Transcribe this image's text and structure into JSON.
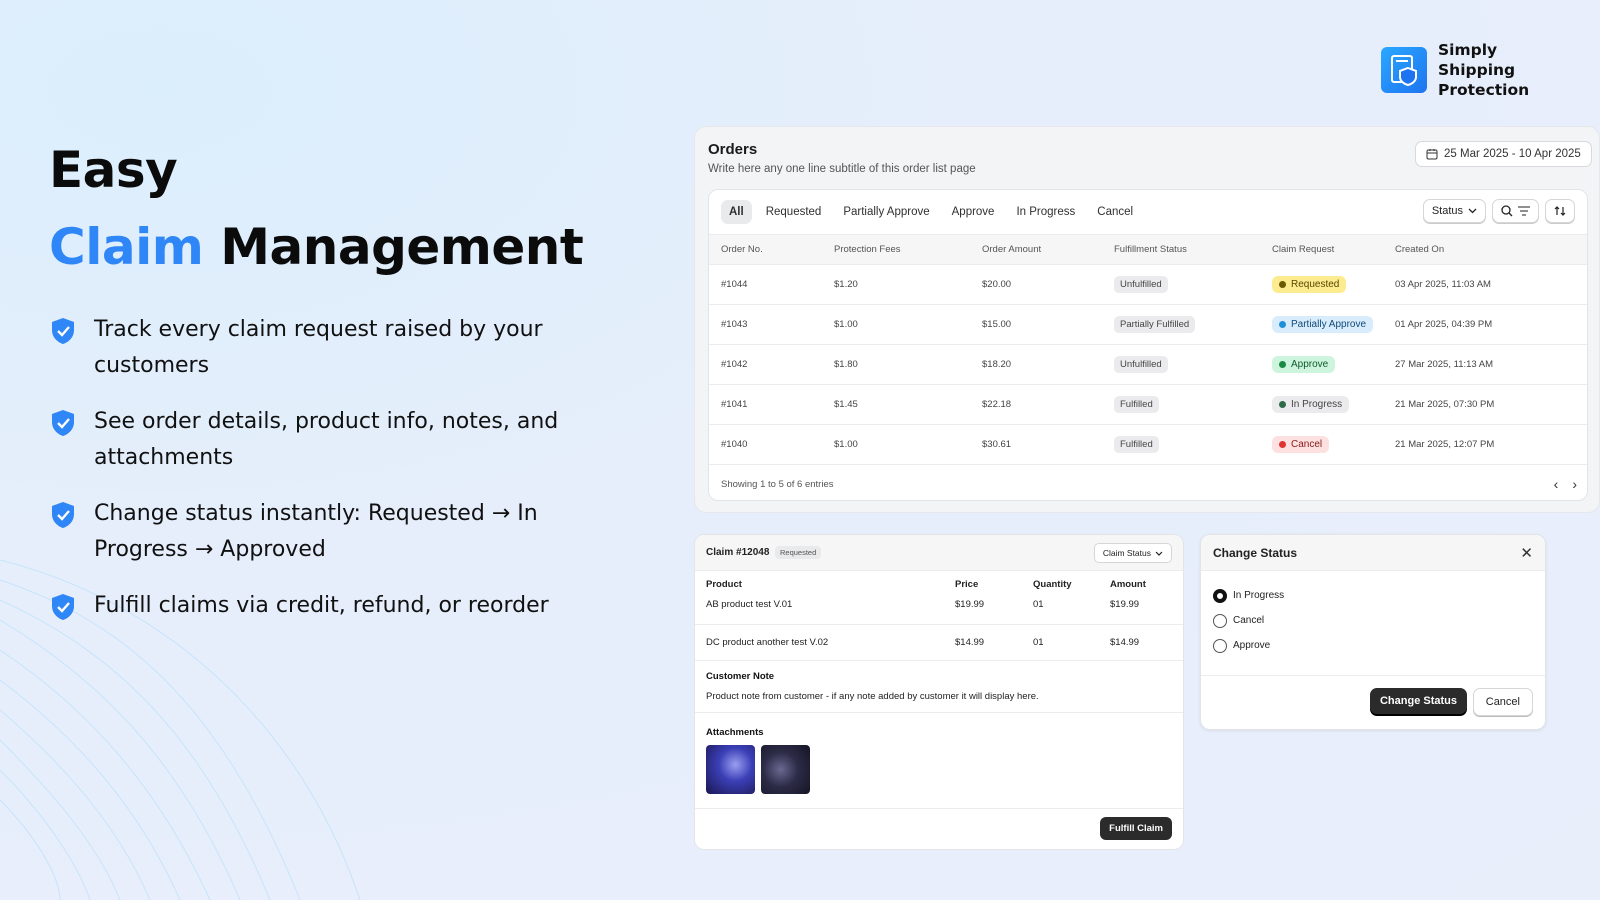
{
  "brand": {
    "name": "Simply Shipping Protection"
  },
  "hero": {
    "title_line1": "Easy",
    "title_accent": "Claim",
    "title_rest": "Management",
    "features": [
      "Track every claim request raised by your customers",
      "See order details, product info, notes, and attachments",
      "Change status instantly: Requested → In Progress → Approved",
      "Fulfill claims via credit, refund, or reorder"
    ]
  },
  "orders": {
    "title": "Orders",
    "subtitle": "Write here any one line subtitle of this order list page",
    "date_range": "25 Mar 2025 - 10 Apr 2025",
    "tabs": [
      "All",
      "Requested",
      "Partially Approve",
      "Approve",
      "In Progress",
      "Cancel"
    ],
    "status_filter_label": "Status",
    "columns": [
      "Order No.",
      "Protection Fees",
      "Order Amount",
      "Fulfillment Status",
      "Claim Request",
      "Created On"
    ],
    "rows": [
      {
        "order": "#1044",
        "fees": "$1.20",
        "amount": "$20.00",
        "fulfillment": "Unfulfilled",
        "claim": "Requested",
        "created": "03 Apr 2025, 11:03 AM"
      },
      {
        "order": "#1043",
        "fees": "$1.00",
        "amount": "$15.00",
        "fulfillment": "Partially Fulfilled",
        "claim": "Partially Approve",
        "created": "01 Apr 2025, 04:39 PM"
      },
      {
        "order": "#1042",
        "fees": "$1.80",
        "amount": "$18.20",
        "fulfillment": "Unfulfilled",
        "claim": "Approve",
        "created": "27 Mar 2025, 11:13 AM"
      },
      {
        "order": "#1041",
        "fees": "$1.45",
        "amount": "$22.18",
        "fulfillment": "Fulfilled",
        "claim": "In Progress",
        "created": "21 Mar 2025, 07:30 PM"
      },
      {
        "order": "#1040",
        "fees": "$1.00",
        "amount": "$30.61",
        "fulfillment": "Fulfilled",
        "claim": "Cancel",
        "created": "21 Mar 2025, 12:07 PM"
      }
    ],
    "footer": "Showing 1 to 5 of 6 entries"
  },
  "claim": {
    "id": "Claim #12048",
    "badge": "Requested",
    "status_button": "Claim Status",
    "columns": [
      "Product",
      "Price",
      "Quantity",
      "Amount"
    ],
    "items": [
      {
        "product": "AB product test V.01",
        "price": "$19.99",
        "qty": "01",
        "amount": "$19.99"
      },
      {
        "product": "DC product another test V.02",
        "price": "$14.99",
        "qty": "01",
        "amount": "$14.99"
      }
    ],
    "note_title": "Customer Note",
    "note_body": "Product note from customer - if any note added by customer it will display here.",
    "attachments_title": "Attachments",
    "fulfill_button": "Fulfill Claim"
  },
  "change_status": {
    "title": "Change Status",
    "options": [
      "In Progress",
      "Cancel",
      "Approve"
    ],
    "selected": "In Progress",
    "confirm": "Change Status",
    "cancel": "Cancel"
  },
  "colors": {
    "accent": "#2f86f6",
    "requested": "#fdeb8f",
    "partially_approve": "#d9ecfb",
    "approve": "#cdf4dc",
    "in_progress": "#ebebed",
    "cancel": "#fde0e0"
  }
}
